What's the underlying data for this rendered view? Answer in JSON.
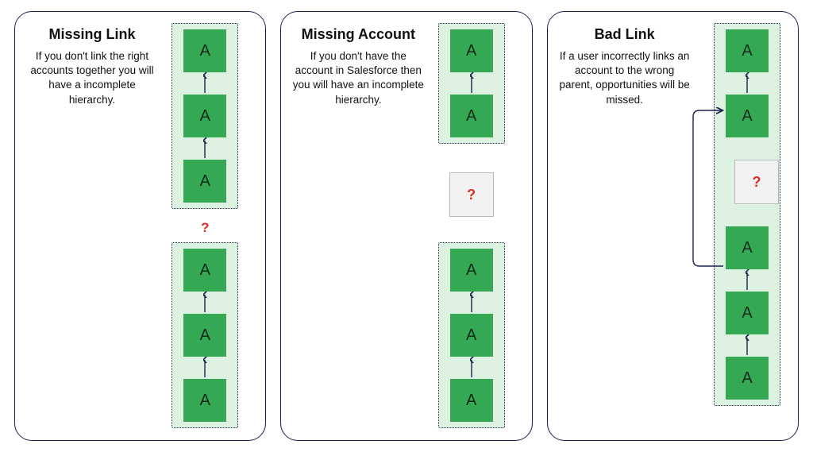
{
  "panels": [
    {
      "title": "Missing Link",
      "desc": "If you don't link the right accounts together you will have a incomplete hierarchy.",
      "node_label": "A",
      "q": "?"
    },
    {
      "title": "Missing Account",
      "desc": "If you don't have the account in Salesforce then you will have an incomplete hierarchy.",
      "node_label": "A",
      "q": "?"
    },
    {
      "title": "Bad Link",
      "desc": "If a user incorrectly links an account to the wrong parent, opportunities will be missed.",
      "node_label": "A",
      "q": "?"
    }
  ],
  "colors": {
    "border": "#1a2250",
    "node": "#34a853",
    "group_bg": "#ddf2e1",
    "error": "#d93025"
  }
}
